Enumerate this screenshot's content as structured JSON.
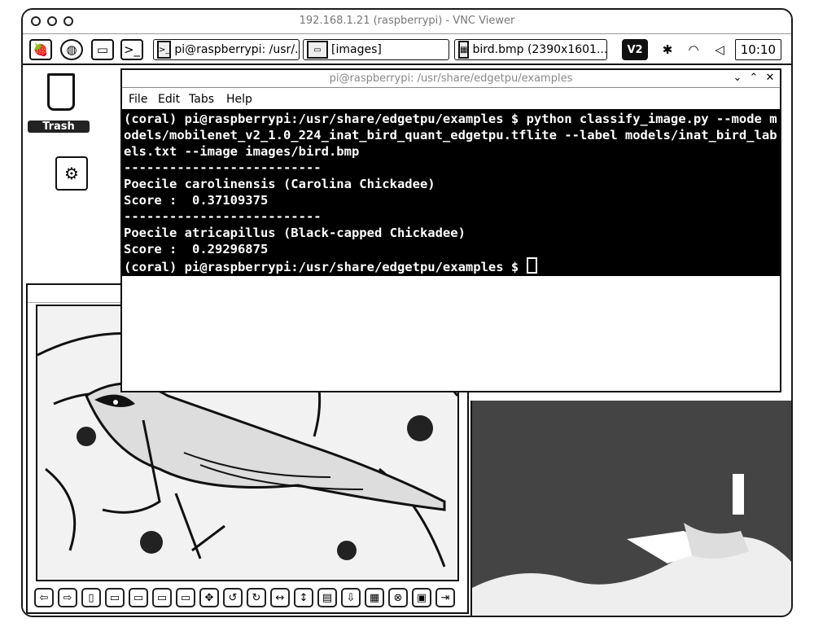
{
  "vnc": {
    "title": "192.168.1.21 (raspberrypi) - VNC Viewer"
  },
  "taskbar": {
    "launchers": [
      {
        "icon": "raspberry-icon"
      },
      {
        "icon": "globe-icon"
      },
      {
        "icon": "folder-icon"
      },
      {
        "icon": "terminal-icon"
      }
    ],
    "tasks": [
      {
        "label": "pi@raspberrypi: /usr/...",
        "icon": "terminal-icon"
      },
      {
        "label": "[images]",
        "icon": "folder-icon"
      },
      {
        "label": "bird.bmp (2390x1601...",
        "icon": "image-icon"
      }
    ],
    "tray": [
      {
        "label": "V2",
        "icon": "vnc-icon"
      },
      {
        "icon": "bluetooth-icon"
      },
      {
        "icon": "wifi-icon"
      },
      {
        "icon": "volume-icon"
      }
    ],
    "clock": "10:10"
  },
  "desktop": {
    "trash_label": "Trash"
  },
  "terminal": {
    "title": "pi@raspberrypi: /usr/share/edgetpu/examples",
    "menu": [
      "File",
      "Edit",
      "Tabs",
      "Help"
    ],
    "lines": [
      "(coral) pi@raspberrypi:/usr/share/edgetpu/examples $ python classify_image.py --mode models/mobilenet_v2_1.0_224_inat_bird_quant_edgetpu.tflite --label models/inat_bird_labels.txt --image images/bird.bmp",
      "--------------------------",
      "Poecile carolinensis (Carolina Chickadee)",
      "Score :  0.37109375",
      "--------------------------",
      "Poecile atricapillus (Black-capped Chickadee)",
      "Score :  0.29296875",
      "(coral) pi@raspberrypi:/usr/share/edgetpu/examples $ "
    ]
  },
  "viewer": {
    "title": "bird.bmp",
    "toolbar": [
      {
        "icon": "back-icon",
        "glyph": "⇦"
      },
      {
        "icon": "forward-icon",
        "glyph": "⇨"
      },
      {
        "icon": "first-icon",
        "glyph": "▯"
      },
      {
        "icon": "zoom-in-icon",
        "glyph": "▭"
      },
      {
        "icon": "zoom-out-icon",
        "glyph": "▭"
      },
      {
        "icon": "fit-icon",
        "glyph": "▭"
      },
      {
        "icon": "actual-size-icon",
        "glyph": "▭"
      },
      {
        "icon": "fullscreen-icon",
        "glyph": "✥"
      },
      {
        "icon": "rotate-left-icon",
        "glyph": "↺"
      },
      {
        "icon": "rotate-right-icon",
        "glyph": "↻"
      },
      {
        "icon": "flip-horizontal-icon",
        "glyph": "↔"
      },
      {
        "icon": "flip-vertical-icon",
        "glyph": "↕"
      },
      {
        "icon": "open-icon",
        "glyph": "▤"
      },
      {
        "icon": "save-icon",
        "glyph": "⇩"
      },
      {
        "icon": "save-as-icon",
        "glyph": "▦"
      },
      {
        "icon": "delete-icon",
        "glyph": "⊗"
      },
      {
        "icon": "preferences-icon",
        "glyph": "▣"
      },
      {
        "icon": "quit-icon",
        "glyph": "⇥"
      }
    ]
  }
}
